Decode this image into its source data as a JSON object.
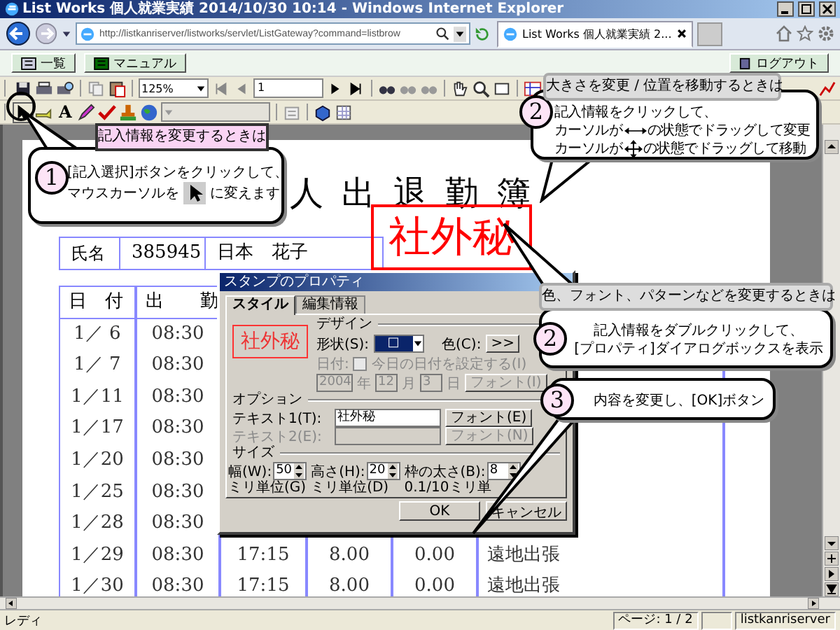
{
  "window": {
    "title": "List Works 個人就業実績 2014/10/30 10:14 - Windows Internet Explorer"
  },
  "address_bar": {
    "url": "http://listkanriserver/listworks/servlet/ListGateway?command=listbrow"
  },
  "tabs": [
    {
      "label": "List Works 個人就業実績 2...",
      "selected": true
    }
  ],
  "app_bar": {
    "buttons": [
      "一覧",
      "マニュアル"
    ],
    "logout": "ログアウト"
  },
  "toolbar": {
    "zoom": "125%",
    "page": "1",
    "text_tool": "A"
  },
  "document": {
    "title": "人出退勤簿",
    "name_row": [
      "氏名",
      "385945",
      "日本　花子"
    ],
    "stamp": "社外秘",
    "columns": [
      "日　付",
      "出　　勤"
    ],
    "rows": [
      {
        "cells": [
          "1／ 6",
          "08:30"
        ]
      },
      {
        "cells": [
          "1／ 7",
          "08:30"
        ]
      },
      {
        "cells": [
          "1／11",
          "08:30"
        ]
      },
      {
        "cells": [
          "1／17",
          "08:30"
        ]
      },
      {
        "cells": [
          "1／20",
          "08:30"
        ]
      },
      {
        "cells": [
          "1／25",
          "08:30"
        ]
      },
      {
        "cells": [
          "1／28",
          "08:30"
        ]
      },
      {
        "cells": [
          "1／29",
          "08:30",
          "17:15",
          "8.00",
          "0.00",
          "遠地出張"
        ]
      },
      {
        "cells": [
          "1／30",
          "08:30",
          "17:15",
          "8.00",
          "0.00",
          "遠地出張"
        ]
      }
    ]
  },
  "dialog": {
    "title": "スタンプのプロパティ",
    "tabs": [
      {
        "label": "スタイル",
        "selected": true
      },
      {
        "label": "編集情報",
        "selected": false
      }
    ],
    "preview": "社外秘",
    "design": {
      "label": "デザイン",
      "shape_label": "形状(S):",
      "shape_value": "□",
      "color_label": "色(C):",
      "color_button": ">>"
    },
    "date": {
      "label": "日付:",
      "checkbox": "今日の日付を設定する(I)",
      "checked": false,
      "disabled": true,
      "year": "2004",
      "year_unit": "年",
      "month": "12",
      "month_unit": "月",
      "day": "3",
      "day_unit": "日",
      "font_button": "フォント(I)"
    },
    "options": {
      "label": "オプション",
      "fields": [
        {
          "label": "テキスト1(T):",
          "value": "社外秘",
          "button": "フォント(E)",
          "disabled": false
        },
        {
          "label": "テキスト2(E):",
          "button": "フォント(N)",
          "disabled": true
        }
      ]
    },
    "size": {
      "label": "サイズ",
      "fields": [
        {
          "label": "幅(W):",
          "value": "50",
          "unit": "ミリ単位(G)"
        },
        {
          "label": "高さ(H):",
          "value": "20",
          "unit": "ミリ単位(D)"
        },
        {
          "label": "枠の太さ(B):",
          "value": "8",
          "unit": "0.1/10ミリ単"
        }
      ]
    },
    "buttons": [
      "OK",
      "キャンセル"
    ]
  },
  "callouts": [
    {
      "heading": "記入情報を変更するときは",
      "number": "1",
      "lines": [
        {
          "kind": "text",
          "text": "[記入選択]ボタンをクリックして、"
        },
        {
          "kind": "cursor",
          "before": "マウスカーソルを",
          "after": "に変えます"
        }
      ]
    },
    {
      "heading": "大きさを変更 / 位置を移動するときは",
      "number": "2",
      "lines": [
        {
          "kind": "text",
          "text": "記入情報をクリックして、"
        },
        {
          "kind": "resize",
          "before": "カーソルが",
          "after": "の状態でドラッグして変更"
        },
        {
          "kind": "move",
          "before": "カーソルが",
          "after": "の状態でドラッグして移動"
        }
      ]
    },
    {
      "heading": "色、フォント、パターンなどを変更するときは",
      "number": "2",
      "lines": [
        {
          "kind": "text",
          "text": "記入情報をダブルクリックして、"
        },
        {
          "kind": "text",
          "text": "[プロパティ]ダイアログボックスを表示"
        }
      ]
    },
    {
      "number": "3",
      "lines": [
        {
          "kind": "text",
          "text": "内容を変更し、[OK]ボタン"
        }
      ]
    }
  ],
  "status_bar": {
    "text": "レディ",
    "page": "ページ: 1 / 2",
    "server": "listkanriserver"
  }
}
